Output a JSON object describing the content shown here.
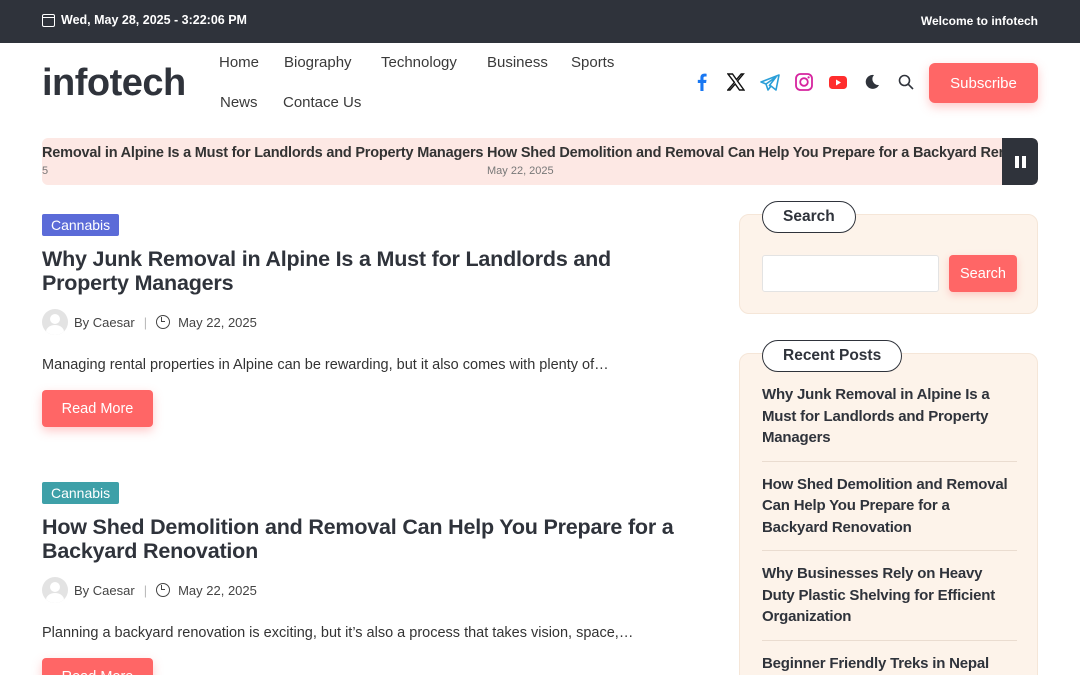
{
  "topbar": {
    "date": "Wed, May 28, 2025 - 3:22:06 PM",
    "welcome": "Welcome to infotech"
  },
  "header": {
    "logo": "infotech",
    "nav": [
      "Home",
      "Biography",
      "Technology",
      "Business",
      "Sports",
      "News",
      "Contace Us"
    ],
    "subscribe_label": "Subscribe",
    "social_icons": [
      "facebook-icon",
      "x-twitter-icon",
      "telegram-icon",
      "instagram-icon",
      "youtube-icon",
      "moon-icon",
      "search-icon"
    ]
  },
  "ticker": {
    "items": [
      {
        "title": "Removal in Alpine Is a Must for Landlords and Property Managers",
        "date": "5"
      },
      {
        "title": "How Shed Demolition and Removal Can Help You Prepare for a Backyard Renovation",
        "date": "May 22, 2025"
      }
    ]
  },
  "posts": [
    {
      "category": "Cannabis",
      "category_color": "#5b6bd8",
      "title": "Why Junk Removal in Alpine Is a Must for Landlords and Property Managers",
      "author": "By Caesar",
      "date": "May 22, 2025",
      "excerpt": "Managing rental properties in Alpine can be rewarding, but it also comes with plenty of…",
      "read_more": "Read More"
    },
    {
      "category": "Cannabis",
      "category_color": "#3ea0a8",
      "title": "How Shed Demolition and Removal Can Help You Prepare for a Backyard Renovation",
      "author": "By Caesar",
      "date": "May 22, 2025",
      "excerpt": "Planning a backyard renovation is exciting, but it’s also a process that takes vision, space,…",
      "read_more": "Read More"
    }
  ],
  "sidebar": {
    "search": {
      "title": "Search",
      "button": "Search",
      "value": ""
    },
    "recent": {
      "title": "Recent Posts",
      "items": [
        "Why Junk Removal in Alpine Is a Must for Landlords and Property Managers",
        "How Shed Demolition and Removal Can Help You Prepare for a Backyard Renovation",
        "Why Businesses Rely on Heavy Duty Plastic Shelving for Efficient Organization",
        "Beginner Friendly Treks in Nepal"
      ]
    }
  },
  "colors": {
    "accent": "#ff6666",
    "dark": "#2f333b",
    "ticker_bg": "#fde8e4",
    "widget_bg": "#fdf3ea"
  }
}
